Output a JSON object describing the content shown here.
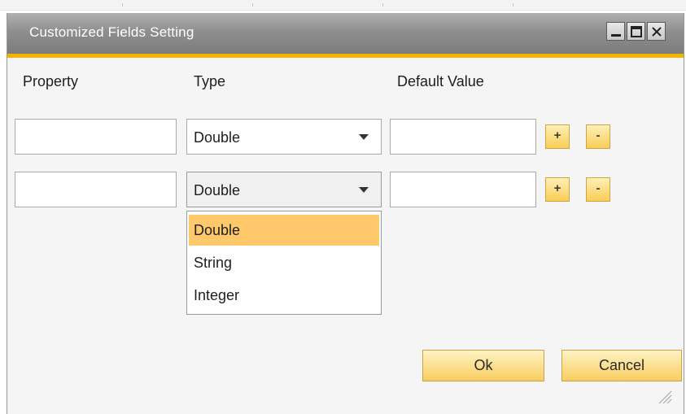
{
  "window": {
    "title": "Customized Fields Setting",
    "controls": {
      "minimize": "minimize-icon",
      "maximize": "maximize-icon",
      "close": "close-icon"
    }
  },
  "columns": {
    "property": "Property",
    "type": "Type",
    "default_value": "Default Value"
  },
  "rows": [
    {
      "property": "",
      "type": "Double",
      "default_value": "",
      "add_label": "+",
      "remove_label": "-"
    },
    {
      "property": "",
      "type": "Double",
      "default_value": "",
      "add_label": "+",
      "remove_label": "-"
    }
  ],
  "type_dropdown": {
    "options": [
      "Double",
      "String",
      "Integer"
    ],
    "highlighted": "Double"
  },
  "buttons": {
    "ok": "Ok",
    "cancel": "Cancel"
  },
  "colors": {
    "accent": "#f1b400",
    "highlight": "#ffc86b",
    "button_top": "#fff3c4",
    "button_bottom": "#f8cd5f"
  }
}
